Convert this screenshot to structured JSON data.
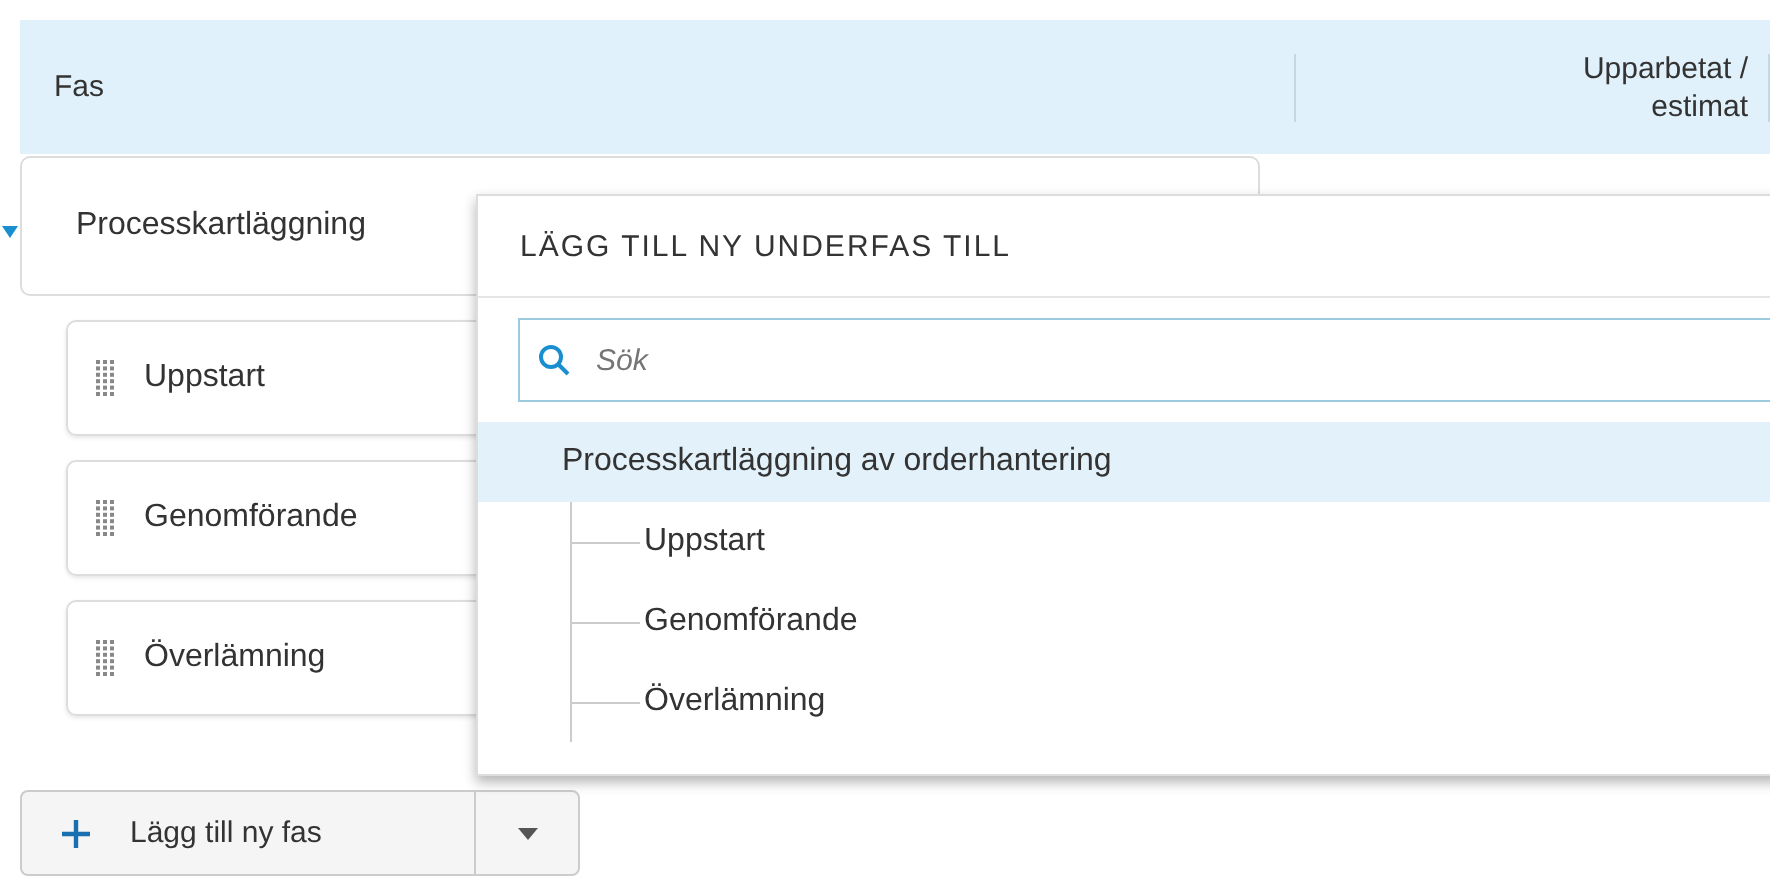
{
  "table": {
    "columns": [
      {
        "label": "Fas"
      },
      {
        "label": "Upparbetat / estimat"
      }
    ]
  },
  "phase": {
    "name": "Processkartläggning",
    "expanded": true,
    "children": [
      {
        "name": "Uppstart"
      },
      {
        "name": "Genomförande"
      },
      {
        "name": "Överlämning"
      }
    ]
  },
  "popup": {
    "title": "LÄGG TILL NY UNDERFAS TILL",
    "search": {
      "placeholder": "Sök"
    },
    "tree": [
      {
        "label": "Processkartläggning av orderhantering",
        "selected": true,
        "children": [
          {
            "label": "Uppstart",
            "selected": false
          },
          {
            "label": "Genomförande",
            "selected": false
          },
          {
            "label": "Överlämning",
            "selected": false
          }
        ]
      }
    ]
  },
  "add_button": {
    "label": "Lägg till ny fas"
  }
}
